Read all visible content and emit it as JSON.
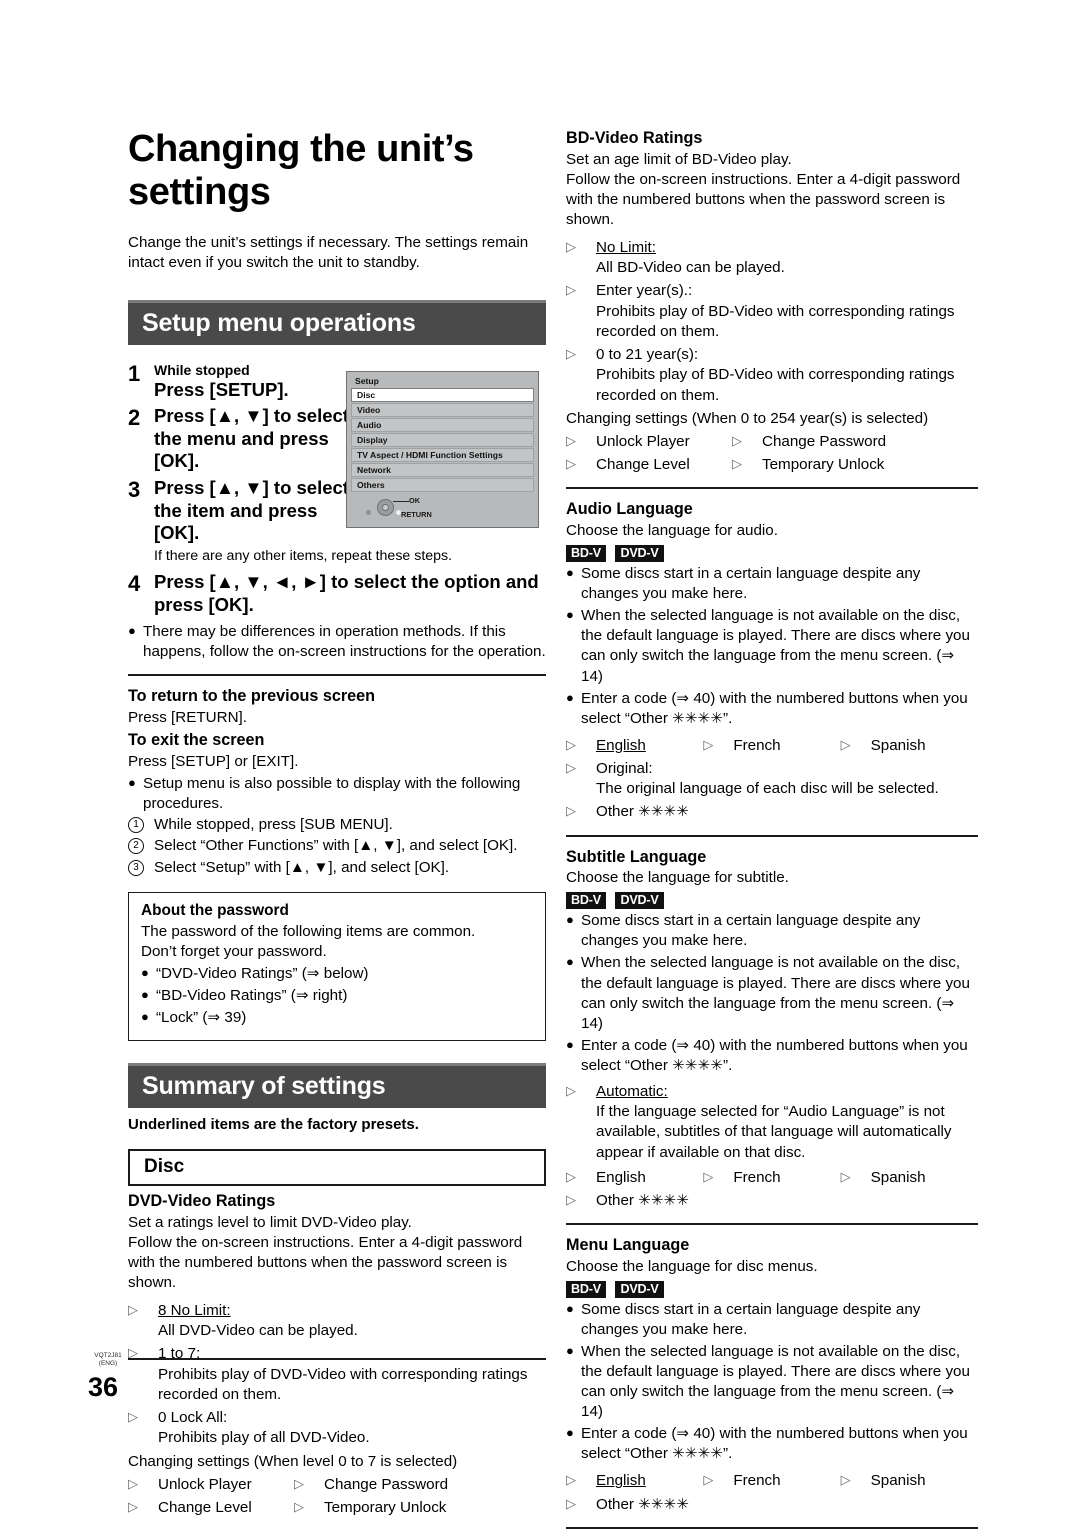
{
  "document": {
    "title": "Changing the unit’s settings",
    "intro": "Change the unit’s settings if necessary. The settings remain intact even if you switch the unit to standby.",
    "page_number": "36",
    "footer_code_line1": "VQT2J81",
    "footer_code_line2": "(ENG)"
  },
  "setup_section": {
    "banner": "Setup menu operations",
    "steps": [
      {
        "num": "1",
        "small": "While stopped",
        "big": "Press [SETUP]."
      },
      {
        "num": "2",
        "small": "",
        "big": "Press [▲, ▼] to select the menu and press [OK]."
      },
      {
        "num": "3",
        "small": "",
        "big": "Press [▲, ▼] to select the item and press [OK].",
        "note": "If there are any other items, repeat these steps."
      },
      {
        "num": "4",
        "small": "",
        "big": "Press [▲, ▼, ◄, ►] to select the option and press [OK]."
      }
    ],
    "after_steps_bullet": "There may be differences in operation methods. If this happens, follow the on-screen instructions for the operation.",
    "return_heading": "To return to the previous screen",
    "return_text": "Press [RETURN].",
    "exit_heading": "To exit the screen",
    "exit_text": "Press [SETUP] or [EXIT].",
    "display_bullet": "Setup menu is also possible to display with the following procedures.",
    "numbered_procedures": [
      {
        "num": "1",
        "text": "While stopped, press [SUB MENU]."
      },
      {
        "num": "2",
        "text": "Select “Other Functions” with [▲, ▼], and select [OK]."
      },
      {
        "num": "3",
        "text": "Select “Setup” with [▲, ▼], and select [OK]."
      }
    ],
    "password_box": {
      "heading": "About the password",
      "line1": "The password of the following items are common.",
      "line2": "Don’t forget your password.",
      "items": [
        "“DVD-Video Ratings”  (⇒ below)",
        "“BD-Video Ratings”  (⇒ right)",
        "“Lock” (⇒ 39)"
      ]
    }
  },
  "setup_screenshot": {
    "title": "Setup",
    "rows": [
      {
        "label": "Disc",
        "selected": true
      },
      {
        "label": "Video",
        "selected": false
      },
      {
        "label": "Audio",
        "selected": false
      },
      {
        "label": "Display",
        "selected": false
      },
      {
        "label": "TV Aspect / HDMI Function Settings",
        "selected": false
      },
      {
        "label": "Network",
        "selected": false
      },
      {
        "label": "Others",
        "selected": false
      }
    ],
    "ok_label": "OK",
    "return_label": "RETURN"
  },
  "summary_section": {
    "banner": "Summary of settings",
    "presets_note": "Underlined items are the factory presets.",
    "disc_box_label": "Disc"
  },
  "dvd_video_ratings": {
    "heading": "DVD-Video Ratings",
    "line1": "Set a ratings level to limit DVD-Video play.",
    "line2": "Follow the on-screen instructions. Enter a 4-digit password with the numbered buttons when the password screen is shown.",
    "options": [
      {
        "label": "8 No Limit:",
        "underlined": true,
        "desc": "All DVD-Video can be played."
      },
      {
        "label": "1 to 7:",
        "underlined": false,
        "desc": "Prohibits play of DVD-Video with corresponding ratings recorded on them."
      },
      {
        "label": "0 Lock All:",
        "underlined": false,
        "desc": "Prohibits play of all DVD-Video."
      }
    ],
    "changing_line": "Changing settings (When level 0 to 7 is selected)",
    "changing_options": [
      "Unlock Player",
      "Change Password",
      "Change Level",
      "Temporary Unlock"
    ]
  },
  "bd_video_ratings": {
    "heading": "BD-Video Ratings",
    "line1": "Set an age limit of BD-Video play.",
    "line2": "Follow the on-screen instructions. Enter a 4-digit password with the numbered buttons when the password screen is shown.",
    "options": [
      {
        "label": "No Limit:",
        "underlined": true,
        "desc": "All BD-Video can be played."
      },
      {
        "label": "Enter year(s).:",
        "underlined": false,
        "desc": "Prohibits play of BD-Video with corresponding ratings recorded on them."
      },
      {
        "label": "0 to 21 year(s):",
        "underlined": false,
        "desc": "Prohibits play of BD-Video with corresponding ratings recorded on them."
      }
    ],
    "changing_line": "Changing settings (When 0 to 254 year(s) is selected)",
    "changing_options": [
      "Unlock Player",
      "Change Password",
      "Change Level",
      "Temporary Unlock"
    ]
  },
  "audio_language": {
    "heading": "Audio Language",
    "line1": "Choose the language for audio.",
    "badges": [
      "BD-V",
      "DVD-V"
    ],
    "bullets": [
      "Some discs start in a certain language despite any changes you make here.",
      "When the selected language is not available on the disc, the default language is played. There are discs where you can only switch the language from the menu screen. (⇒ 14)",
      "Enter a code (⇒ 40) with the numbered buttons when you select “Other ✳✳✳✳”."
    ],
    "lang_row": [
      {
        "label": "English",
        "underlined": true
      },
      {
        "label": "French",
        "underlined": false
      },
      {
        "label": "Spanish",
        "underlined": false
      }
    ],
    "extra_options": [
      {
        "label": "Original:",
        "underlined": false,
        "desc": "The original language of each disc will be selected."
      }
    ],
    "other_option": "Other ✳✳✳✳"
  },
  "subtitle_language": {
    "heading": "Subtitle Language",
    "line1": "Choose the language for subtitle.",
    "badges": [
      "BD-V",
      "DVD-V"
    ],
    "bullets": [
      "Some discs start in a certain language despite any changes you make here.",
      "When the selected language is not available on the disc, the default language is played. There are discs where you can only switch the language from the menu screen. (⇒ 14)",
      "Enter a code (⇒ 40) with the numbered buttons when you select “Other ✳✳✳✳”."
    ],
    "extra_options": [
      {
        "label": "Automatic:",
        "underlined": true,
        "desc": "If the language selected for “Audio Language” is not available, subtitles of that language will automatically appear if available on that disc."
      }
    ],
    "lang_row": [
      {
        "label": "English",
        "underlined": false
      },
      {
        "label": "French",
        "underlined": false
      },
      {
        "label": "Spanish",
        "underlined": false
      }
    ],
    "other_option": "Other ✳✳✳✳"
  },
  "menu_language": {
    "heading": "Menu Language",
    "line1": "Choose the language for disc menus.",
    "badges": [
      "BD-V",
      "DVD-V"
    ],
    "bullets": [
      "Some discs start in a certain language despite any changes you make here.",
      "When the selected language is not available on the disc, the default language is played. There are discs where you can only switch the language from the menu screen. (⇒ 14)",
      "Enter a code (⇒ 40) with the numbered buttons when you select “Other ✳✳✳✳”."
    ],
    "lang_row": [
      {
        "label": "English",
        "underlined": true
      },
      {
        "label": "French",
        "underlined": false
      },
      {
        "label": "Spanish",
        "underlined": false
      }
    ],
    "other_option": "Other ✳✳✳✳"
  },
  "glyphs": {
    "triangle": "▷",
    "bullet": "●"
  }
}
